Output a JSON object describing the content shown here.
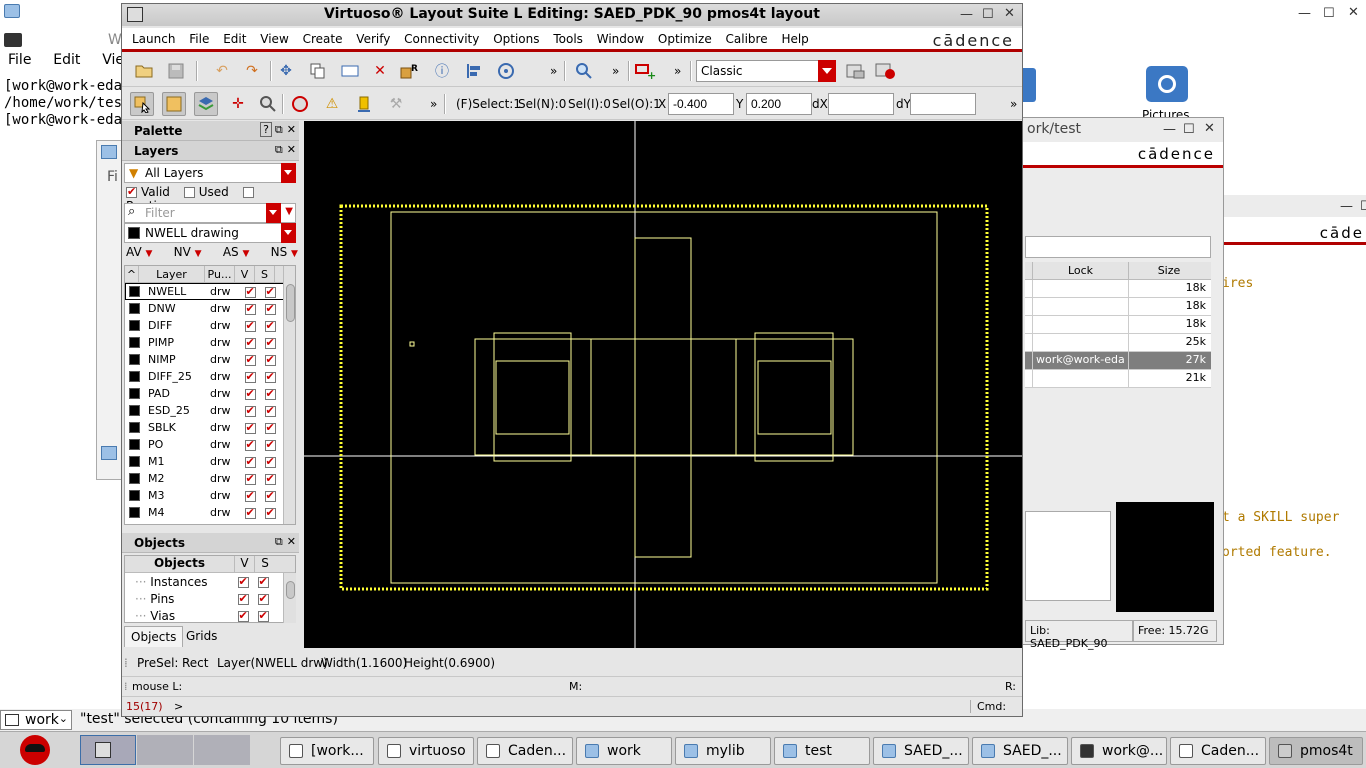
{
  "desktop": {
    "terminal_menu": [
      "File",
      "Edit",
      "View"
    ],
    "terminal_lines": [
      "[work@work-eda",
      "/home/work/test",
      "[work@work-eda"
    ],
    "terminal_title_partial": "W",
    "fi_partial": "Fi",
    "pictures_label": "Pictures",
    "status_text": "\"test\" selected (containing 10 items)",
    "workspace_label": "work"
  },
  "libmgr": {
    "title": "ork/test",
    "logo": "cādence",
    "columns": [
      "Lock",
      "Size"
    ],
    "rows": [
      {
        "lock": "",
        "size": "18k",
        "selected": false
      },
      {
        "lock": "",
        "size": "18k",
        "selected": false
      },
      {
        "lock": "",
        "size": "18k",
        "selected": false
      },
      {
        "lock": "",
        "size": "25k",
        "selected": false
      },
      {
        "lock": "work@work-eda",
        "size": "27k",
        "selected": true
      },
      {
        "lock": "",
        "size": "21k",
        "selected": false
      }
    ],
    "lib_status": "Lib: SAED_PDK_90",
    "free_status": "Free: 15.72G"
  },
  "rightwin": {
    "logo": "cāde",
    "line1": "ires",
    "line2": "t a SKILL super",
    "line3": "orted feature."
  },
  "main": {
    "title": "Virtuoso® Layout Suite L Editing: SAED_PDK_90 pmos4t layout",
    "menu": [
      "Launch",
      "File",
      "Edit",
      "View",
      "Create",
      "Verify",
      "Connectivity",
      "Options",
      "Tools",
      "Window",
      "Optimize",
      "Calibre",
      "Help"
    ],
    "logo": "cādence",
    "workspace_combo": "Classic",
    "select_info": {
      "fselect": "(F)Select:1",
      "seln": "Sel(N):0",
      "seli": "Sel(I):0",
      "selo": "Sel(O):1"
    },
    "coords": {
      "x_label": "X",
      "x_value": "-0.400",
      "y_label": "Y",
      "y_value": "0.200",
      "dx_label": "dX",
      "dx_value": "",
      "dy_label": "dY",
      "dy_value": ""
    }
  },
  "palette": {
    "title": "Palette",
    "layers_title": "Layers",
    "layer_filter": "All Layers",
    "valid_label": "Valid",
    "used_label": "Used",
    "routing_label": "Routing",
    "filter_placeholder": "Filter",
    "current_layer": "NWELL drawing",
    "vis_buttons": [
      "AV",
      "NV",
      "AS",
      "NS"
    ],
    "table_headers": [
      "Layer",
      "Pu...",
      "V",
      "S"
    ],
    "layers": [
      {
        "name": "NWELL",
        "purpose": "drw"
      },
      {
        "name": "DNW",
        "purpose": "drw"
      },
      {
        "name": "DIFF",
        "purpose": "drw"
      },
      {
        "name": "PIMP",
        "purpose": "drw"
      },
      {
        "name": "NIMP",
        "purpose": "drw"
      },
      {
        "name": "DIFF_25",
        "purpose": "drw"
      },
      {
        "name": "PAD",
        "purpose": "drw"
      },
      {
        "name": "ESD_25",
        "purpose": "drw"
      },
      {
        "name": "SBLK",
        "purpose": "drw"
      },
      {
        "name": "PO",
        "purpose": "drw"
      },
      {
        "name": "M1",
        "purpose": "drw"
      },
      {
        "name": "M2",
        "purpose": "drw"
      },
      {
        "name": "M3",
        "purpose": "drw"
      },
      {
        "name": "M4",
        "purpose": "drw"
      }
    ],
    "objects_title": "Objects",
    "objects_header": "Objects",
    "objects": [
      "Instances",
      "Pins",
      "Vias"
    ],
    "tabs": [
      "Objects",
      "Grids"
    ]
  },
  "status": {
    "presel": "PreSel:",
    "shape": "Rect",
    "layer": "Layer(NWELL drw)",
    "width": "Width(1.1600)",
    "height": "Height(0.6900)",
    "mouse_l": "mouse L:",
    "mouse_m": "M:",
    "mouse_r": "R:",
    "counter": "15(17)",
    "prompt": ">",
    "cmd": "Cmd:"
  },
  "taskbar": [
    {
      "label": "[work...",
      "active": false
    },
    {
      "label": "virtuoso",
      "active": false
    },
    {
      "label": "Caden...",
      "active": false
    },
    {
      "label": "work",
      "active": false
    },
    {
      "label": "mylib",
      "active": false
    },
    {
      "label": "test",
      "active": false
    },
    {
      "label": "SAED_...",
      "active": false
    },
    {
      "label": "SAED_...",
      "active": false
    },
    {
      "label": "work@...",
      "active": false
    },
    {
      "label": "Caden...",
      "active": false
    },
    {
      "label": "pmos4t",
      "active": true
    }
  ],
  "colors": {
    "cadence_red": "#b00000",
    "shape_yellow": "#ffff66",
    "canvas_bg": "#000000"
  }
}
